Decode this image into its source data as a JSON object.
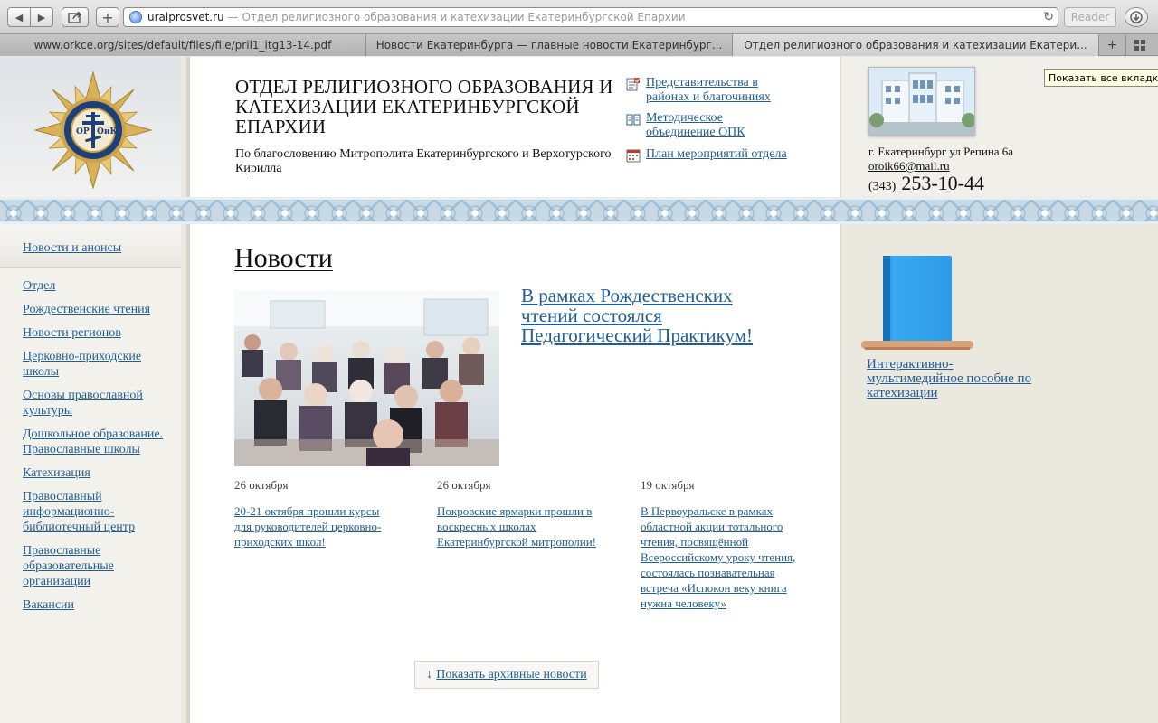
{
  "browser": {
    "url_domain": "uralprosvet.ru",
    "url_title": "— Отдел религиозного образования и катехизации Екатеринбургской Епархии",
    "reader_label": "Reader",
    "tabs": [
      {
        "label": "www.orkce.org/sites/default/files/file/pril1_itg13-14.pdf"
      },
      {
        "label": "Новости Екатеринбурга — главные новости Екатеринбург..."
      },
      {
        "label": "Отдел религиозного образования и катехизации Екатери..."
      }
    ],
    "tooltip": "Показать все вкладки"
  },
  "header": {
    "title": "ОТДЕЛ РЕЛИГИОЗНОГО ОБРАЗОВАНИЯ И КАТЕХИЗАЦИИ ЕКАТЕРИНБУРГСКОЙ ЕПАРХИИ",
    "subtitle": "По благословению Митрополита Екатеринбургского и Верхотурского Кирилла",
    "links": {
      "reps": "Представительства в районах и благочиниях",
      "method": "Методическое объединение ОПК",
      "plan": "План мероприятий отдела"
    },
    "contacts": {
      "address": "г. Екатеринбург ул Репина 6а",
      "email": "oroik66@mail.ru",
      "phone_code": "(343)",
      "phone_number": "253-10-44"
    }
  },
  "sidebar": {
    "items": [
      {
        "label": "Новости и анонсы"
      },
      {
        "label": "Отдел"
      },
      {
        "label": "Рождественские чтения"
      },
      {
        "label": "Новости регионов"
      },
      {
        "label": "Церковно-приходские школы"
      },
      {
        "label": "Основы православной культуры"
      },
      {
        "label": "Дошкольное образование. Православные школы"
      },
      {
        "label": "Катехизация"
      },
      {
        "label": "Православный информационно-библиотечный центр"
      },
      {
        "label": "Православные образовательные организации"
      },
      {
        "label": "Вакансии"
      }
    ]
  },
  "news": {
    "heading": "Новости",
    "lead_title": "В рамках Рождественских чтений состоялся Педагогический Практикум!",
    "items": [
      {
        "date": "26 октября",
        "text": "20-21 октября прошли курсы для руководителей церковно-приходских школ!"
      },
      {
        "date": "26 октября",
        "text": "Покровские ярмарки прошли в воскресных школах Екатеринбургской митрополии!"
      },
      {
        "date": "19 октября",
        "text": "В Первоуральске в рамках областной акции тотального чтения, посвящённой Всероссийскому уроку чтения, состоялась познавательная встреча «Испокон веку книга нужна человеку»"
      }
    ],
    "archive_arrow": "↓",
    "archive_label": "Показать архивные новости"
  },
  "right": {
    "ad_link": "Интерактивно-мультимедийное пособие по катехизации"
  },
  "colors": {
    "link": "#1f5e95",
    "ornament": "#c8d9e6",
    "emblem_gold": "#c9a24a",
    "emblem_blue": "#1d3f7a"
  },
  "icons": [
    "back-icon",
    "forward-icon",
    "share-icon",
    "plus-icon",
    "globe-icon",
    "reload-icon",
    "download-icon",
    "emblem-seal",
    "phone-icon",
    "book-icon",
    "calendar-icon",
    "building-photo"
  ]
}
